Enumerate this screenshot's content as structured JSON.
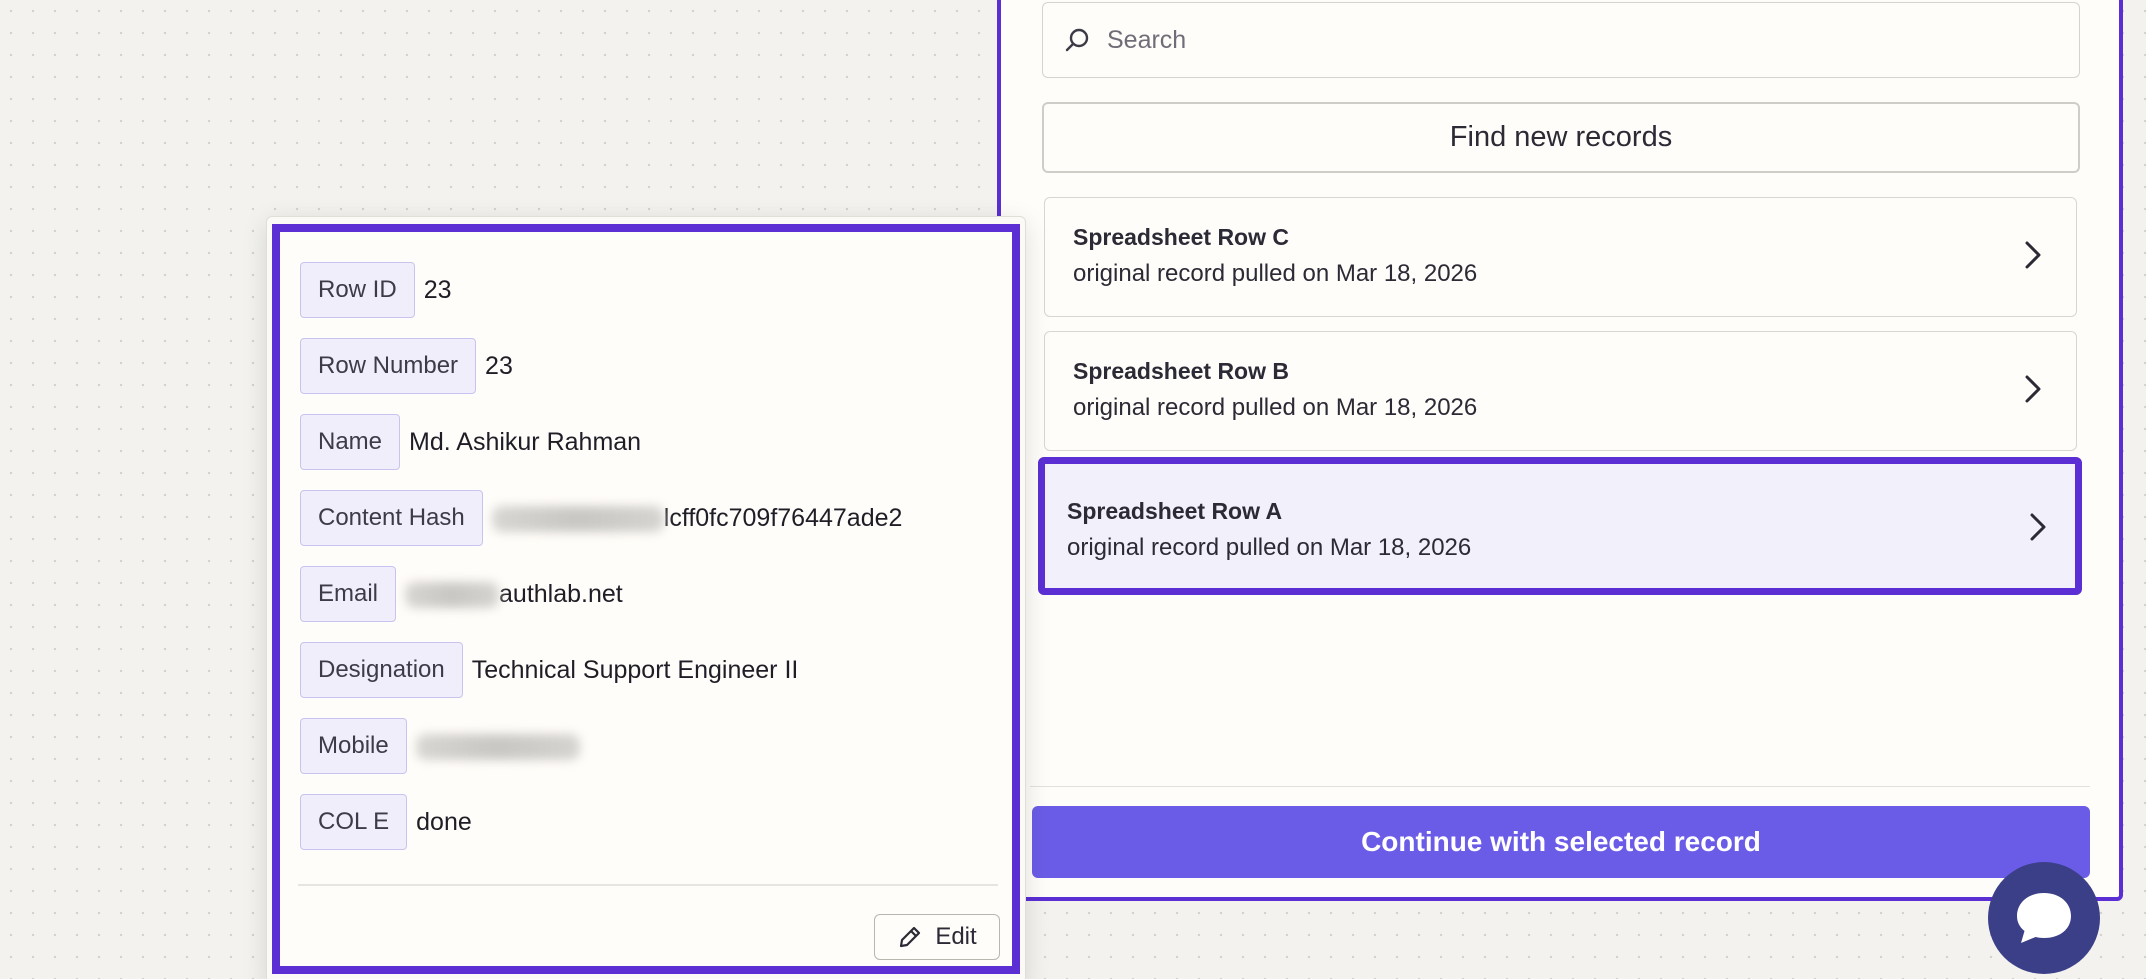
{
  "search": {
    "placeholder": "Search"
  },
  "find_button": {
    "label": "Find new records"
  },
  "records": [
    {
      "title": "Spreadsheet Row C",
      "subtitle": "original record pulled on Mar 18, 2026",
      "selected": false
    },
    {
      "title": "Spreadsheet Row B",
      "subtitle": "original record pulled on Mar 18, 2026",
      "selected": false
    },
    {
      "title": "Spreadsheet Row A",
      "subtitle": "original record pulled on Mar 18, 2026",
      "selected": true
    }
  ],
  "continue_button": {
    "label": "Continue with selected record"
  },
  "detail": {
    "fields": [
      {
        "label": "Row ID",
        "value": "23"
      },
      {
        "label": "Row Number",
        "value": "23"
      },
      {
        "label": "Name",
        "value": "Md. Ashikur Rahman"
      },
      {
        "label": "Content Hash",
        "value": "lcff0fc709f76447ade2",
        "redacted_prefix": true
      },
      {
        "label": "Email",
        "value": "authlab.net",
        "redacted_prefix": true
      },
      {
        "label": "Designation",
        "value": "Technical Support Engineer II"
      },
      {
        "label": "Mobile",
        "value": "",
        "redacted_prefix": true
      },
      {
        "label": "COL E",
        "value": "done"
      }
    ],
    "edit_label": "Edit"
  },
  "colors": {
    "accent": "#5b2fd3",
    "button": "#6b5ce7",
    "chat": "#3a3f88"
  },
  "icons": {
    "search": "search-icon",
    "chevron": "chevron-right-icon",
    "edit": "pencil-icon",
    "chat": "chat-bubble-icon"
  }
}
